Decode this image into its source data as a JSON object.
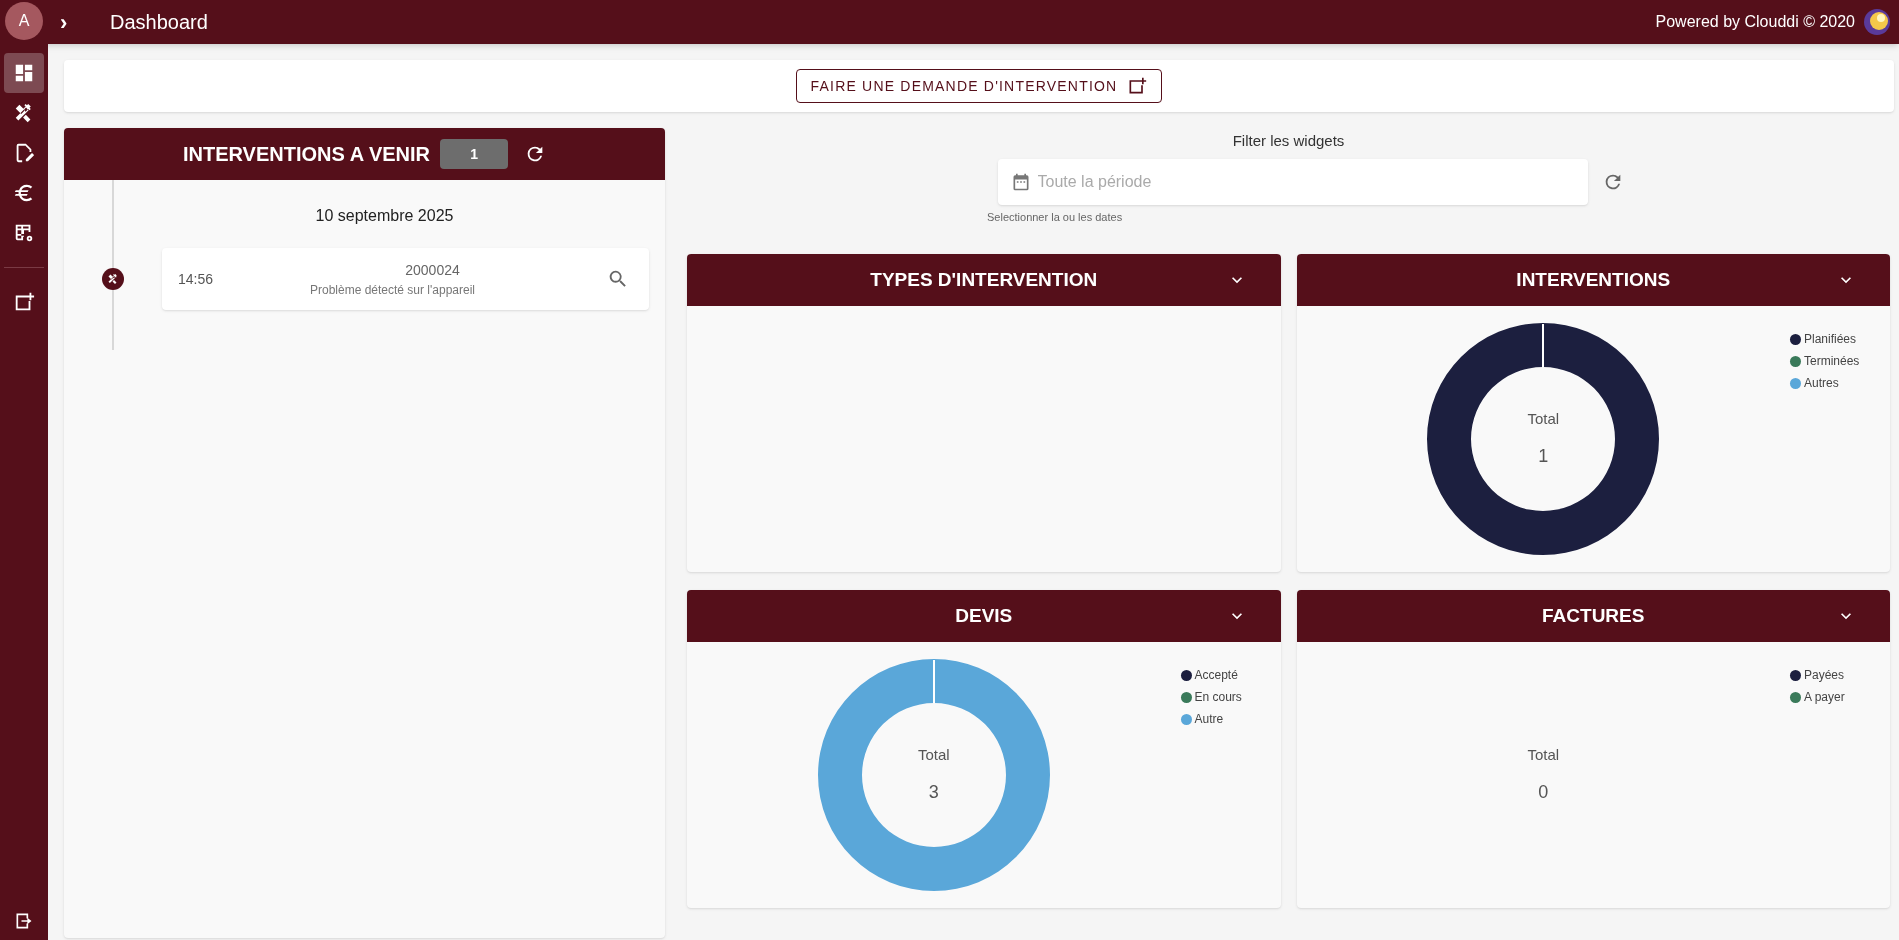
{
  "top_bar": {
    "avatar": "A",
    "expand": "›",
    "title": "Dashboard",
    "credit": "Powered by Clouddi © 2020"
  },
  "sidebar": {
    "items": [
      {
        "selected": true
      },
      {
        "selected": false
      },
      {
        "selected": false
      },
      {
        "selected": false
      },
      {
        "selected": false
      }
    ]
  },
  "request_button": "FAIRE UNE DEMANDE D'INTERVENTION",
  "upcoming": {
    "title": "INTERVENTIONS A VENIR",
    "count": "1",
    "date": "10 septembre 2025",
    "events": [
      {
        "time": "14:56",
        "number": "2000024",
        "description": "Problème détecté sur l'appareil"
      }
    ]
  },
  "filter": {
    "label": "Filter les widgets",
    "placeholder": "Toute la période",
    "helper": "Selectionner la ou les dates"
  },
  "widgets": [
    {
      "title": "TYPES D'INTERVENTION"
    },
    {
      "title": "INTERVENTIONS",
      "center_label": "Total",
      "center_value": "1",
      "ring": {
        "color": "#1c1f3f"
      },
      "legend": [
        {
          "label": "Planifiées",
          "color": "#1c1f3f"
        },
        {
          "label": "Terminées",
          "color": "#3a7a5a"
        },
        {
          "label": "Autres",
          "color": "#5aa7d9"
        }
      ]
    },
    {
      "title": "DEVIS",
      "center_label": "Total",
      "center_value": "3",
      "ring": {
        "color": "#5aa7d9"
      },
      "legend": [
        {
          "label": "Accepté",
          "color": "#1c1f3f"
        },
        {
          "label": "En cours",
          "color": "#3a7a5a"
        },
        {
          "label": "Autre",
          "color": "#5aa7d9"
        }
      ]
    },
    {
      "title": "FACTURES",
      "center_label": "Total",
      "center_value": "0",
      "legend": [
        {
          "label": "Payées",
          "color": "#1c1f3f"
        },
        {
          "label": "A payer",
          "color": "#3a7a5a"
        }
      ]
    }
  ]
}
